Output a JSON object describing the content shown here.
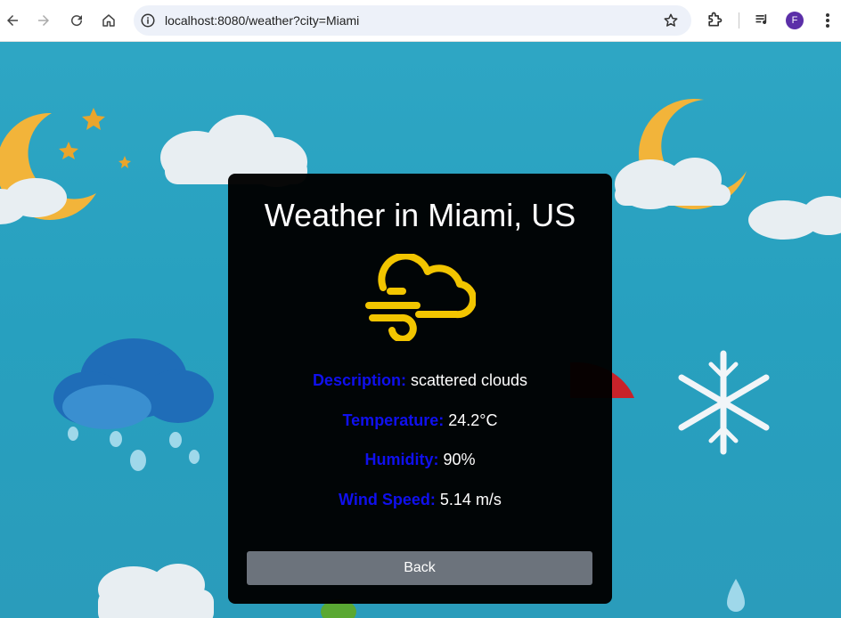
{
  "browser": {
    "url": "localhost:8080/weather?city=Miami",
    "profile_initial": "F"
  },
  "weather": {
    "title": "Weather in Miami, US",
    "icon": "wind-cloud-icon",
    "accent_color": "#f2c500",
    "label_color": "#1010ee",
    "rows": [
      {
        "label": "Description:",
        "value": "scattered clouds"
      },
      {
        "label": "Temperature:",
        "value": "24.2°C"
      },
      {
        "label": "Humidity:",
        "value": "90%"
      },
      {
        "label": "Wind Speed:",
        "value": "5.14 m/s"
      }
    ],
    "back_label": "Back"
  }
}
